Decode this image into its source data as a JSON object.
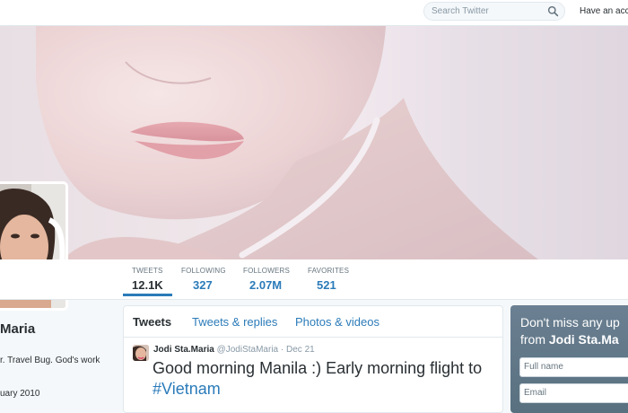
{
  "topbar": {
    "search_placeholder": "Search Twitter",
    "account_text": "Have an acco"
  },
  "stats": [
    {
      "label": "TWEETS",
      "value": "12.1K"
    },
    {
      "label": "FOLLOWING",
      "value": "327"
    },
    {
      "label": "FOLLOWERS",
      "value": "2.07M"
    },
    {
      "label": "FAVORITES",
      "value": "521"
    }
  ],
  "profile": {
    "name_partial": "Maria",
    "bio_partial": "r. Travel Bug. God's work",
    "joined_partial": "uary 2010"
  },
  "timeline": {
    "tabs": [
      "Tweets",
      "Tweets & replies",
      "Photos & videos"
    ],
    "tweet": {
      "name": "Jodi Sta.Maria",
      "handle": "@JodiStaMaria",
      "separator": "·",
      "date": "Dec 21",
      "text": "Good morning Manila :) Early morning flight to",
      "hashtag": "#Vietnam"
    }
  },
  "signup": {
    "line1": "Don't miss any up",
    "line2_prefix": "from ",
    "line2_name": "Jodi Sta.Ma",
    "full_name_placeholder": "Full name",
    "email_placeholder": "Email"
  },
  "colors": {
    "link": "#2b7bb9",
    "background": "#f5f8fa",
    "signup_panel": "#5b7083"
  }
}
